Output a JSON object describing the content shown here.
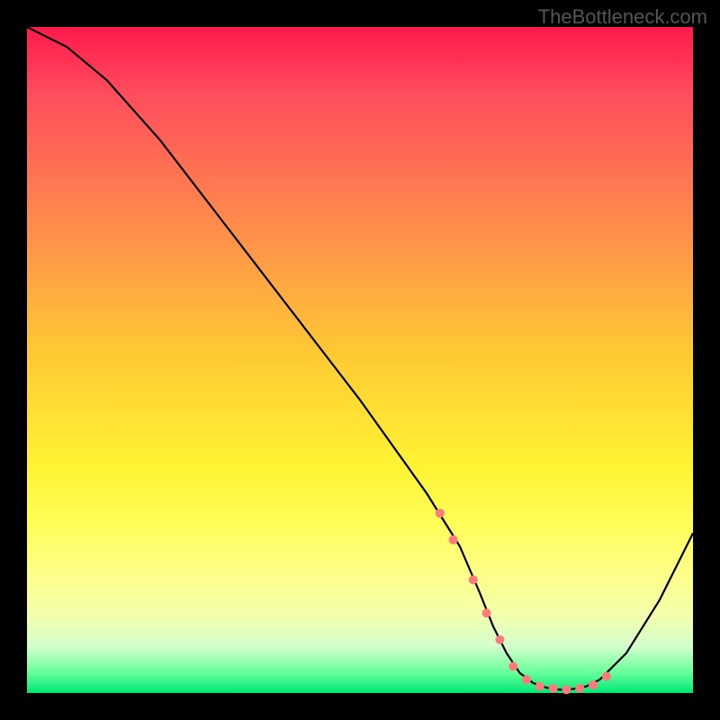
{
  "watermark": "TheBottleneck.com",
  "chart_data": {
    "type": "line",
    "title": "",
    "xlabel": "",
    "ylabel": "",
    "xlim": [
      0,
      100
    ],
    "ylim": [
      0,
      100
    ],
    "series": [
      {
        "name": "bottleneck-curve",
        "x": [
          0,
          6,
          12,
          20,
          30,
          40,
          50,
          60,
          65,
          68,
          70,
          72,
          74,
          76,
          78,
          80,
          82,
          84,
          86,
          90,
          95,
          100
        ],
        "values": [
          100,
          97,
          92,
          83,
          70,
          57,
          44,
          30,
          22,
          15,
          10,
          6,
          3,
          1.5,
          0.8,
          0.5,
          0.6,
          1,
          2,
          6,
          14,
          24
        ]
      }
    ],
    "markers": {
      "name": "highlight-dots",
      "color": "#ff7a7a",
      "x": [
        62,
        64,
        67,
        69,
        71,
        73,
        75,
        77,
        79,
        81,
        83,
        85,
        87
      ],
      "values": [
        27,
        23,
        17,
        12,
        8,
        4,
        2,
        1,
        0.7,
        0.5,
        0.7,
        1.2,
        2.5
      ]
    }
  },
  "colors": {
    "curve": "#000000",
    "marker": "#ff7a7a",
    "background_frame": "#000000"
  }
}
